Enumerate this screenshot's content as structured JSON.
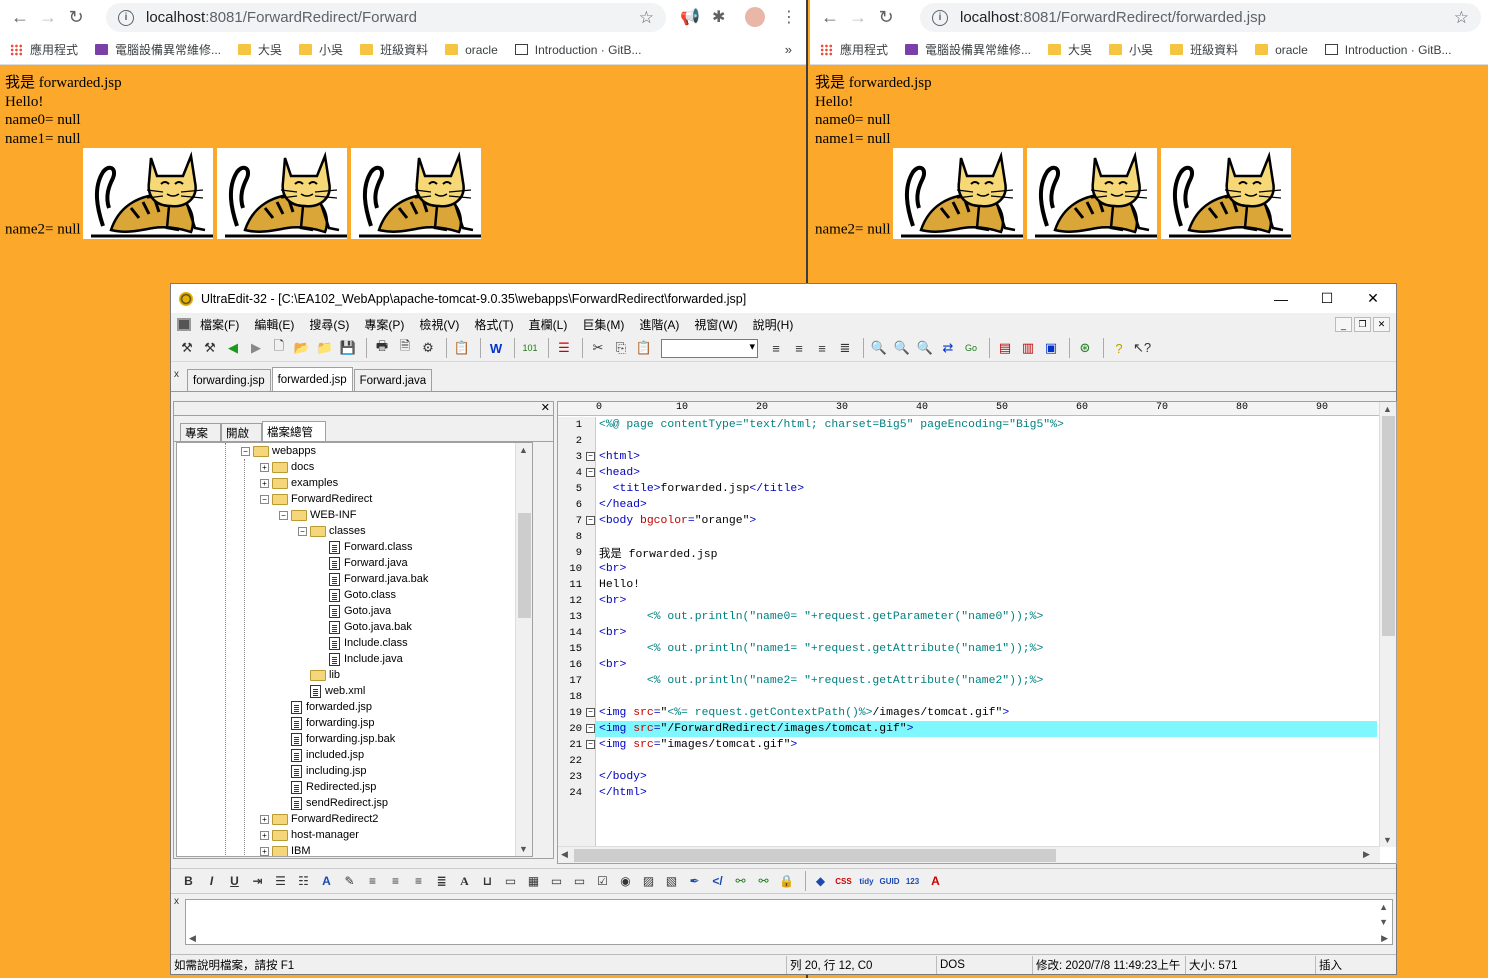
{
  "left_browser": {
    "url_host": "localhost",
    "url_path": ":8081/ForwardRedirect/Forward",
    "page": {
      "line1": "我是 forwarded.jsp",
      "line2": "Hello!",
      "line3": "name0= null",
      "line4": "name1= null",
      "line5": "name2= null"
    }
  },
  "right_browser": {
    "url_host": "localhost",
    "url_path": ":8081/ForwardRedirect/forwarded.jsp",
    "page": {
      "line1": "我是 forwarded.jsp",
      "line2": "Hello!",
      "line3": "name0= null",
      "line4": "name1= null",
      "line5": "name2= null"
    }
  },
  "bookmarks_left": [
    "應用程式",
    "電腦設備異常維修...",
    "大吳",
    "小吳",
    "班級資料",
    "oracle",
    "Introduction · GitB..."
  ],
  "bookmarks_right": [
    "應用程式",
    "電腦設備異常維修...",
    "大吳",
    "小吳",
    "班級資料",
    "oracle",
    "Introduction · GitB..."
  ],
  "bookmark_more": "»",
  "ultraedit": {
    "title": "UltraEdit-32 - [C:\\EA102_WebApp\\apache-tomcat-9.0.35\\webapps\\ForwardRedirect\\forwarded.jsp]",
    "menu": [
      "檔案(F)",
      "編輯(E)",
      "搜尋(S)",
      "專案(P)",
      "檢視(V)",
      "格式(T)",
      "直欄(L)",
      "巨集(M)",
      "進階(A)",
      "視窗(W)",
      "說明(H)"
    ],
    "file_tabs": [
      "forwarding.jsp",
      "forwarded.jsp",
      "Forward.java"
    ],
    "panel_tabs": [
      "專案",
      "開啟",
      "檔案總管"
    ],
    "tree": [
      {
        "label": "webapps",
        "type": "folder-open",
        "level": 0,
        "pm": "−"
      },
      {
        "label": "docs",
        "type": "folder",
        "level": 1,
        "pm": "+"
      },
      {
        "label": "examples",
        "type": "folder",
        "level": 1,
        "pm": "+"
      },
      {
        "label": "ForwardRedirect",
        "type": "folder-open",
        "level": 1,
        "pm": "−"
      },
      {
        "label": "WEB-INF",
        "type": "folder-open",
        "level": 2,
        "pm": "−"
      },
      {
        "label": "classes",
        "type": "folder-open",
        "level": 3,
        "pm": "−"
      },
      {
        "label": "Forward.class",
        "type": "file",
        "level": 4
      },
      {
        "label": "Forward.java",
        "type": "file",
        "level": 4
      },
      {
        "label": "Forward.java.bak",
        "type": "file",
        "level": 4
      },
      {
        "label": "Goto.class",
        "type": "file",
        "level": 4
      },
      {
        "label": "Goto.java",
        "type": "file",
        "level": 4
      },
      {
        "label": "Goto.java.bak",
        "type": "file",
        "level": 4
      },
      {
        "label": "Include.class",
        "type": "file",
        "level": 4
      },
      {
        "label": "Include.java",
        "type": "file",
        "level": 4
      },
      {
        "label": "lib",
        "type": "folder",
        "level": 3
      },
      {
        "label": "web.xml",
        "type": "file",
        "level": 3
      },
      {
        "label": "forwarded.jsp",
        "type": "file",
        "level": 2
      },
      {
        "label": "forwarding.jsp",
        "type": "file",
        "level": 2
      },
      {
        "label": "forwarding.jsp.bak",
        "type": "file",
        "level": 2
      },
      {
        "label": "included.jsp",
        "type": "file",
        "level": 2
      },
      {
        "label": "including.jsp",
        "type": "file",
        "level": 2
      },
      {
        "label": "Redirected.jsp",
        "type": "file",
        "level": 2
      },
      {
        "label": "sendRedirect.jsp",
        "type": "file",
        "level": 2
      },
      {
        "label": "ForwardRedirect2",
        "type": "folder",
        "level": 1,
        "pm": "+"
      },
      {
        "label": "host-manager",
        "type": "folder",
        "level": 1,
        "pm": "+"
      },
      {
        "label": "IBM",
        "type": "folder",
        "level": 1,
        "pm": "+"
      }
    ],
    "ruler_labels": [
      "0",
      "10",
      "20",
      "30",
      "40",
      "50",
      "60",
      "70",
      "80",
      "90"
    ],
    "code_lines": [
      {
        "n": "1",
        "fold": "",
        "parts": [
          [
            "jsp",
            "<%@ page contentType=\"text/html; charset=Big5\" pageEncoding=\"Big5\"%>"
          ]
        ]
      },
      {
        "n": "2",
        "fold": "",
        "parts": []
      },
      {
        "n": "3",
        "fold": "-",
        "parts": [
          [
            "tag",
            "<html>"
          ]
        ]
      },
      {
        "n": "4",
        "fold": "-",
        "parts": [
          [
            "tag",
            "<head>"
          ]
        ]
      },
      {
        "n": "5",
        "fold": "",
        "parts": [
          [
            "plain",
            "  "
          ],
          [
            "tag",
            "<title>"
          ],
          [
            "plain",
            "forwarded.jsp"
          ],
          [
            "tag",
            "</title>"
          ]
        ]
      },
      {
        "n": "6",
        "fold": "",
        "parts": [
          [
            "tag",
            "</head>"
          ]
        ]
      },
      {
        "n": "7",
        "fold": "-",
        "parts": [
          [
            "tag",
            "<body "
          ],
          [
            "attr",
            "bgcolor"
          ],
          [
            "tag",
            "="
          ],
          [
            "str",
            "\"orange\""
          ],
          [
            "tag",
            ">"
          ]
        ]
      },
      {
        "n": "8",
        "fold": "",
        "parts": []
      },
      {
        "n": "9",
        "fold": "",
        "parts": [
          [
            "plain",
            "我是 forwarded.jsp"
          ]
        ]
      },
      {
        "n": "10",
        "fold": "",
        "parts": [
          [
            "tag",
            "<br>"
          ]
        ]
      },
      {
        "n": "11",
        "fold": "",
        "parts": [
          [
            "plain",
            "Hello!"
          ]
        ]
      },
      {
        "n": "12",
        "fold": "",
        "parts": [
          [
            "tag",
            "<br>"
          ]
        ]
      },
      {
        "n": "13",
        "fold": "",
        "parts": [
          [
            "jsp",
            "       <% out.println(\"name0= \"+request.getParameter(\"name0\"));%>"
          ]
        ]
      },
      {
        "n": "14",
        "fold": "",
        "parts": [
          [
            "tag",
            "<br>"
          ]
        ]
      },
      {
        "n": "15",
        "fold": "",
        "parts": [
          [
            "jsp",
            "       <% out.println(\"name1= \"+request.getAttribute(\"name1\"));%>"
          ]
        ]
      },
      {
        "n": "16",
        "fold": "",
        "parts": [
          [
            "tag",
            "<br>"
          ]
        ]
      },
      {
        "n": "17",
        "fold": "",
        "parts": [
          [
            "jsp",
            "       <% out.println(\"name2= \"+request.getAttribute(\"name2\"));%>"
          ]
        ]
      },
      {
        "n": "18",
        "fold": "",
        "parts": []
      },
      {
        "n": "19",
        "fold": "-",
        "parts": [
          [
            "tag",
            "<img "
          ],
          [
            "attr",
            "src"
          ],
          [
            "tag",
            "="
          ],
          [
            "str",
            "\""
          ],
          [
            "jsp",
            "<%= request.getContextPath()%>"
          ],
          [
            "str",
            "/images/tomcat.gif\""
          ],
          [
            "tag",
            ">"
          ]
        ]
      },
      {
        "n": "20",
        "fold": "-",
        "highlight": true,
        "parts": [
          [
            "tag",
            "<img "
          ],
          [
            "attr",
            "src"
          ],
          [
            "tag",
            "="
          ],
          [
            "str",
            "\"/ForwardRedirect/images/tomcat.gif\""
          ],
          [
            "tag",
            ">"
          ]
        ]
      },
      {
        "n": "21",
        "fold": "-",
        "parts": [
          [
            "tag",
            "<img "
          ],
          [
            "attr",
            "src"
          ],
          [
            "tag",
            "="
          ],
          [
            "str",
            "\"images/tomcat.gif\""
          ],
          [
            "tag",
            ">"
          ]
        ]
      },
      {
        "n": "22",
        "fold": "",
        "parts": []
      },
      {
        "n": "23",
        "fold": "",
        "parts": [
          [
            "tag",
            "</body>"
          ]
        ]
      },
      {
        "n": "24",
        "fold": "",
        "parts": [
          [
            "tag",
            "</html>"
          ]
        ]
      }
    ],
    "status": {
      "help": "如需說明檔案，請按 F1",
      "position": "列 20, 行 12, C0",
      "format": "DOS",
      "modified": "修改: 2020/7/8 11:49:23上午",
      "size": "大小: 571",
      "mode": "插入"
    }
  },
  "colors": {
    "page_bg": "#fca82a",
    "highlight": "#7ff7ff",
    "tag": "#0000c0",
    "attr": "#c00000",
    "jsp": "#008080"
  }
}
